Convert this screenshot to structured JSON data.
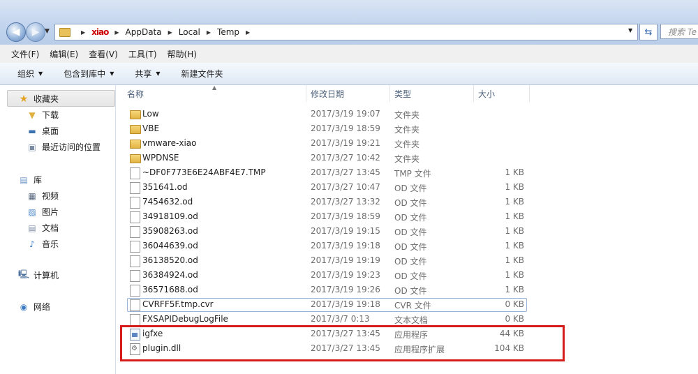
{
  "address": {
    "crumbs": [
      "xiao",
      "AppData",
      "Local",
      "Temp"
    ],
    "search_placeholder": "搜索 Te"
  },
  "menu": [
    "文件(F)",
    "编辑(E)",
    "查看(V)",
    "工具(T)",
    "帮助(H)"
  ],
  "commands": [
    {
      "label": "组织",
      "dropdown": true
    },
    {
      "label": "包含到库中",
      "dropdown": true
    },
    {
      "label": "共享",
      "dropdown": true
    },
    {
      "label": "新建文件夹",
      "dropdown": false
    }
  ],
  "nav": {
    "favorites": {
      "label": "收藏夹",
      "icon": "star-icon"
    },
    "fav_items": [
      {
        "label": "下载",
        "icon": "download-folder-icon"
      },
      {
        "label": "桌面",
        "icon": "desktop-icon"
      },
      {
        "label": "最近访问的位置",
        "icon": "recent-places-icon"
      }
    ],
    "libraries": {
      "label": "库",
      "icon": "library-icon"
    },
    "lib_items": [
      {
        "label": "视频",
        "icon": "video-icon"
      },
      {
        "label": "图片",
        "icon": "pictures-icon"
      },
      {
        "label": "文档",
        "icon": "documents-icon"
      },
      {
        "label": "音乐",
        "icon": "music-icon"
      }
    ],
    "computer": {
      "label": "计算机",
      "icon": "computer-icon"
    },
    "network": {
      "label": "网络",
      "icon": "network-icon"
    }
  },
  "columns": {
    "name": "名称",
    "date": "修改日期",
    "type": "类型",
    "size": "大小"
  },
  "files": [
    {
      "name": "Low",
      "date": "2017/3/19 19:07",
      "type": "文件夹",
      "size": "",
      "icon": "folder"
    },
    {
      "name": "VBE",
      "date": "2017/3/19 18:59",
      "type": "文件夹",
      "size": "",
      "icon": "folder"
    },
    {
      "name": "vmware-xiao",
      "date": "2017/3/19 19:21",
      "type": "文件夹",
      "size": "",
      "icon": "folder"
    },
    {
      "name": "WPDNSE",
      "date": "2017/3/27 10:42",
      "type": "文件夹",
      "size": "",
      "icon": "folder"
    },
    {
      "name": "~DF0F773E6E24ABF4E7.TMP",
      "date": "2017/3/27 13:45",
      "type": "TMP 文件",
      "size": "1 KB",
      "icon": "file"
    },
    {
      "name": "351641.od",
      "date": "2017/3/27 10:47",
      "type": "OD 文件",
      "size": "1 KB",
      "icon": "file"
    },
    {
      "name": "7454632.od",
      "date": "2017/3/27 13:32",
      "type": "OD 文件",
      "size": "1 KB",
      "icon": "file"
    },
    {
      "name": "34918109.od",
      "date": "2017/3/19 18:59",
      "type": "OD 文件",
      "size": "1 KB",
      "icon": "file"
    },
    {
      "name": "35908263.od",
      "date": "2017/3/19 19:15",
      "type": "OD 文件",
      "size": "1 KB",
      "icon": "file"
    },
    {
      "name": "36044639.od",
      "date": "2017/3/19 19:18",
      "type": "OD 文件",
      "size": "1 KB",
      "icon": "file"
    },
    {
      "name": "36138520.od",
      "date": "2017/3/19 19:19",
      "type": "OD 文件",
      "size": "1 KB",
      "icon": "file"
    },
    {
      "name": "36384924.od",
      "date": "2017/3/19 19:23",
      "type": "OD 文件",
      "size": "1 KB",
      "icon": "file"
    },
    {
      "name": "36571688.od",
      "date": "2017/3/19 19:26",
      "type": "OD 文件",
      "size": "1 KB",
      "icon": "file"
    },
    {
      "name": "CVRFF5F.tmp.cvr",
      "date": "2017/3/19 19:18",
      "type": "CVR 文件",
      "size": "0 KB",
      "icon": "file"
    },
    {
      "name": "FXSAPIDebugLogFile",
      "date": "2017/3/7 0:13",
      "type": "文本文档",
      "size": "0 KB",
      "icon": "file"
    },
    {
      "name": "igfxe",
      "date": "2017/3/27 13:45",
      "type": "应用程序",
      "size": "44 KB",
      "icon": "exe"
    },
    {
      "name": "plugin.dll",
      "date": "2017/3/27 13:45",
      "type": "应用程序扩展",
      "size": "104 KB",
      "icon": "dll"
    }
  ],
  "colors": {
    "highlight_box": "#d61b1b",
    "selection_border": "#99b4d4"
  }
}
